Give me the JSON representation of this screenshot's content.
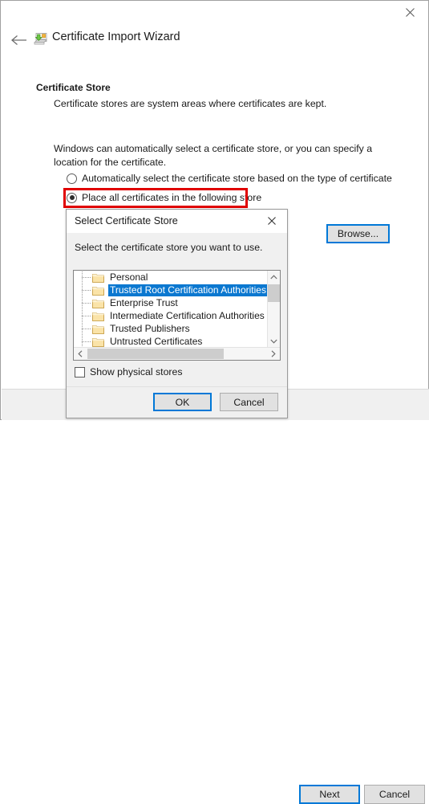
{
  "window": {
    "title": "Certificate Import Wizard",
    "close_label": "✕",
    "back_label": "←",
    "icon": "certificate-wizard-icon"
  },
  "page": {
    "heading": "Certificate Store",
    "subheading": "Certificate stores are system areas where certificates are kept.",
    "intro": "Windows can automatically select a certificate store, or you can specify a location for the certificate."
  },
  "options": {
    "auto_label": "Automatically select the certificate store based on the type of certificate",
    "auto_selected": false,
    "place_label": "Place all certificates in the following store",
    "place_selected": true,
    "store_value": "",
    "store_placeholder": "",
    "browse_label": "Browse...",
    "highlight_color": "#e00000"
  },
  "footer": {
    "next_label": "Next",
    "cancel_label": "Cancel"
  },
  "modal": {
    "title": "Select Certificate Store",
    "close_label": "✕",
    "prompt": "Select the certificate store you want to use.",
    "tree_items": [
      {
        "label": "Personal",
        "selected": false
      },
      {
        "label": "Trusted Root Certification Authorities",
        "selected": true
      },
      {
        "label": "Enterprise Trust",
        "selected": false
      },
      {
        "label": "Intermediate Certification Authorities",
        "selected": false
      },
      {
        "label": "Trusted Publishers",
        "selected": false
      },
      {
        "label": "Untrusted Certificates",
        "selected": false
      }
    ],
    "show_physical_label": "Show physical stores",
    "show_physical_checked": false,
    "ok_label": "OK",
    "cancel_label": "Cancel",
    "scroll_up_icon": "chevron-up-icon",
    "scroll_down_icon": "chevron-down-icon",
    "scroll_left_icon": "chevron-left-icon",
    "scroll_right_icon": "chevron-right-icon"
  },
  "colors": {
    "selection_blue": "#0b78d0",
    "focus_blue": "#0078d7",
    "highlight_red": "#e00000",
    "dialog_gray": "#f0f0f0"
  }
}
